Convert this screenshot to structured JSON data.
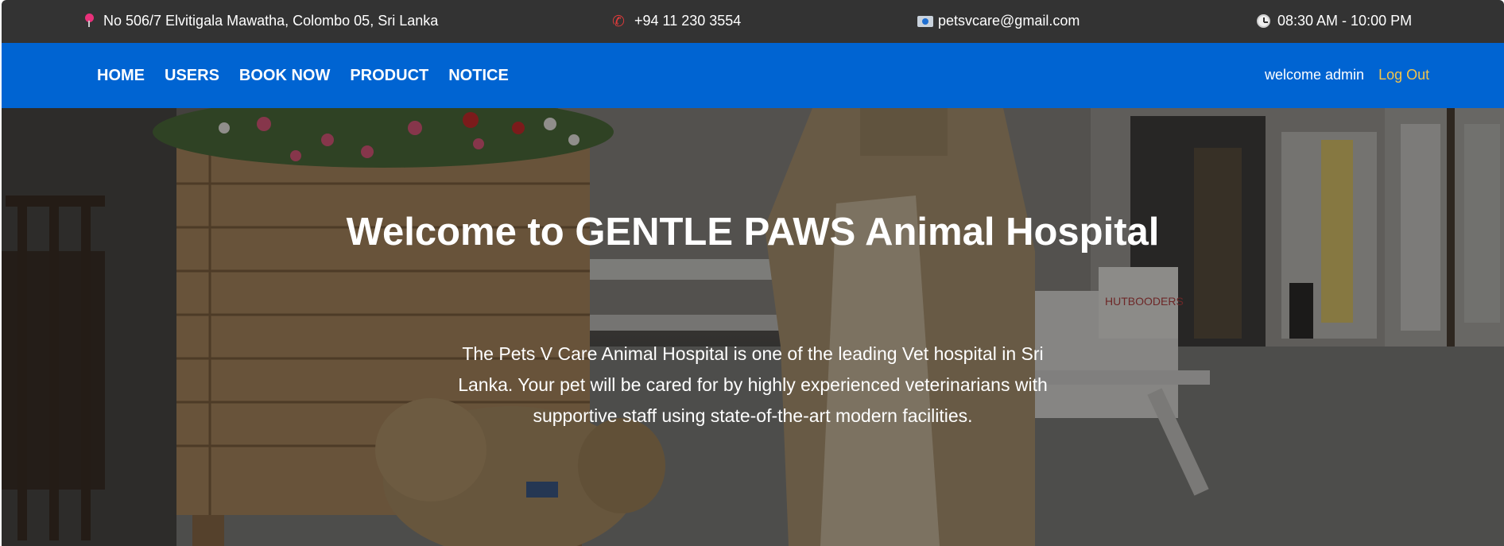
{
  "topbar": {
    "address": {
      "icon": "map-pin-icon",
      "text": "No 506/7 Elvitigala Mawatha, Colombo 05, Sri Lanka"
    },
    "phone": {
      "icon": "phone-icon",
      "text": "+94 11 230 3554"
    },
    "email": {
      "icon": "mailbox-icon",
      "text": "petsvcare@gmail.com"
    },
    "hours": {
      "icon": "clock-icon",
      "text": "08:30 AM - 10:00 PM"
    }
  },
  "nav": {
    "links": [
      {
        "label": "HOME"
      },
      {
        "label": "USERS"
      },
      {
        "label": "BOOK NOW"
      },
      {
        "label": "PRODUCT"
      },
      {
        "label": "NOTICE"
      }
    ],
    "welcome": "welcome admin",
    "logout": "Log Out"
  },
  "hero": {
    "title": "Welcome to GENTLE PAWS Animal Hospital",
    "description": "The Pets V Care Animal Hospital is one of the leading Vet hospital in Sri Lanka. Your pet will be cared for by highly experienced veterinarians with supportive staff using state-of-the-art modern facilities.",
    "planter_sign": "HUTBOODERS"
  },
  "colors": {
    "topbar_bg": "#333333",
    "nav_bg": "#0064d2",
    "logout": "#f3c54a",
    "text": "#ffffff"
  }
}
